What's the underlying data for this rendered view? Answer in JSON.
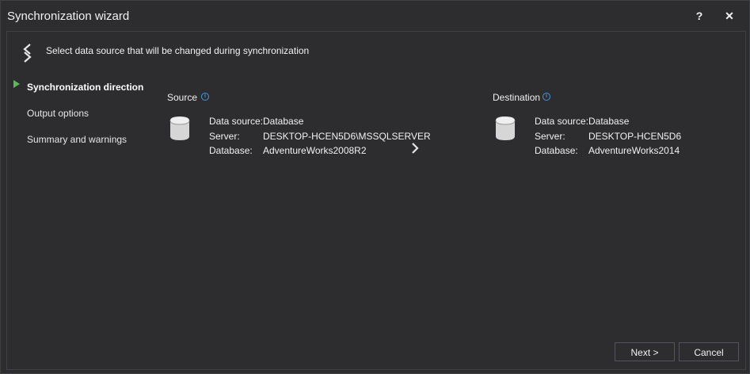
{
  "window": {
    "title": "Synchronization wizard",
    "help_label": "?",
    "close_label": "✕"
  },
  "header": {
    "text": "Select data source that will be changed during synchronization"
  },
  "nav": {
    "items": [
      {
        "label": "Synchronization direction",
        "active": true
      },
      {
        "label": "Output options",
        "active": false
      },
      {
        "label": "Summary and warnings",
        "active": false
      }
    ]
  },
  "source": {
    "title": "Source",
    "rows": [
      {
        "key": "Data source:",
        "value": "Database"
      },
      {
        "key": "Server:",
        "value": "DESKTOP-HCEN5D6\\MSSQLSERVER"
      },
      {
        "key": "Database:",
        "value": "AdventureWorks2008R2"
      }
    ]
  },
  "destination": {
    "title": "Destination",
    "rows": [
      {
        "key": "Data source:",
        "value": "Database"
      },
      {
        "key": "Server:",
        "value": "DESKTOP-HCEN5D6"
      },
      {
        "key": "Database:",
        "value": "AdventureWorks2014"
      }
    ]
  },
  "footer": {
    "next_label": "Next >",
    "cancel_label": "Cancel"
  },
  "colors": {
    "background": "#2d2d30",
    "border": "#3f3f46",
    "accent_green": "#5fb95c",
    "info_blue": "#3a9be6"
  }
}
